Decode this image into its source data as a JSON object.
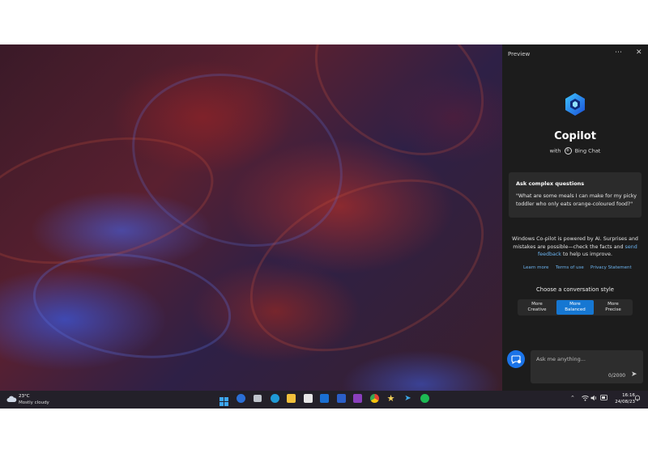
{
  "panel": {
    "header_title": "Preview",
    "more_icon": "more-icon",
    "close_icon": "close-icon",
    "app_name": "Copilot",
    "subtitle_prefix": "with",
    "subtitle_brand": "Bing Chat",
    "card": {
      "heading": "Ask complex questions",
      "question": "\"What are some meals I can make for my picky toddler who only eats orange-coloured food?\""
    },
    "disclaimer_part1": "Windows Co-pilot is powered by AI. Surprises and mistakes are possible—check the facts and ",
    "disclaimer_link": "send feedback",
    "disclaimer_part2": " to help us improve.",
    "links": {
      "learn_more": "Learn more",
      "terms": "Terms of use",
      "privacy": "Privacy Statement"
    },
    "style_heading": "Choose a conversation style",
    "styles": [
      {
        "line1": "More",
        "line2": "Creative",
        "active": false
      },
      {
        "line1": "More",
        "line2": "Balanced",
        "active": true
      },
      {
        "line1": "More",
        "line2": "Precise",
        "active": false
      }
    ],
    "input_placeholder": "Ask me anything...",
    "char_counter": "0/2000",
    "colors": {
      "accent": "#1677d2",
      "panel_bg": "#1c1c1c",
      "card_bg": "#2b2b2b",
      "link": "#6cb4f0"
    }
  },
  "taskbar": {
    "weather_temp": "23°C",
    "weather_condition": "Mostly cloudy",
    "apps": [
      "windows-start-icon",
      "news-icon",
      "task-view-icon",
      "edge-icon",
      "file-explorer-icon",
      "store-icon",
      "outlook-icon",
      "word-icon",
      "onenote-icon",
      "chrome-icon",
      "star-app-icon",
      "telegram-icon",
      "spotify-icon"
    ],
    "time": "16:16",
    "date": "24/08/23"
  }
}
